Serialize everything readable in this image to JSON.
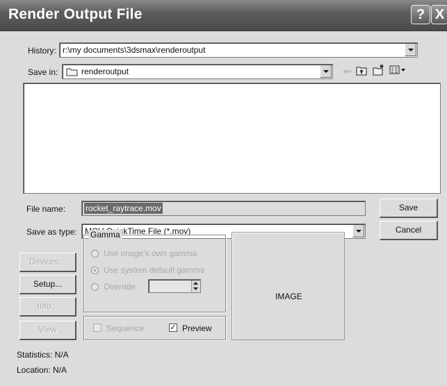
{
  "window": {
    "title": "Render Output File",
    "help_glyph": "?",
    "close_glyph": "X"
  },
  "history": {
    "label": "History:",
    "value": "r:\\my documents\\3dsmax\\renderoutput"
  },
  "save_in": {
    "label": "Save in:",
    "value": "renderoutput"
  },
  "file_name": {
    "label": "File name:",
    "value": "rocket_raytrace.mov"
  },
  "save_as_type": {
    "label": "Save as type:",
    "value": "MOV QuickTime File (*.mov)"
  },
  "buttons": {
    "save": "Save",
    "cancel": "Cancel",
    "devices": "Devices...",
    "setup": "Setup...",
    "info": "Info...",
    "view": "View"
  },
  "gamma": {
    "title": "Gamma",
    "options": [
      "Use image's own gamma",
      "Use system default gamma",
      "Override"
    ],
    "selected": "Use system default gamma",
    "override_value": ""
  },
  "sequence": {
    "label": "Sequence",
    "checked": false
  },
  "preview_check": {
    "label": "Preview",
    "checked": true
  },
  "image_box": {
    "label": "IMAGE"
  },
  "info": {
    "statistics": "Statistics: N/A",
    "location": "Location: N/A"
  },
  "icons": [
    "back-arrow-icon",
    "up-folder-icon",
    "new-folder-icon",
    "view-menu-icon",
    "folder-icon"
  ]
}
